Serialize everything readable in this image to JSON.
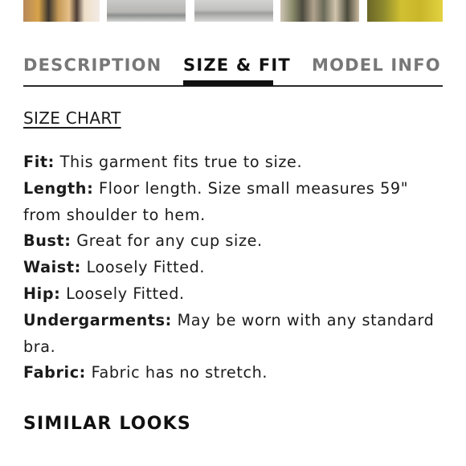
{
  "thumbnails": [
    {
      "label": "product-photo-1"
    },
    {
      "label": "product-photo-2"
    },
    {
      "label": "product-photo-3"
    },
    {
      "label": "product-photo-4"
    },
    {
      "label": "product-photo-5"
    }
  ],
  "tabs": [
    {
      "label": "DESCRIPTION",
      "active": false
    },
    {
      "label": "SIZE & FIT",
      "active": true
    },
    {
      "label": "MODEL INFO",
      "active": false
    }
  ],
  "size_chart_link": "SIZE CHART",
  "details": [
    {
      "label": "Fit:",
      "text": " This garment fits true to size."
    },
    {
      "label": "Length:",
      "text": " Floor length. Size small measures 59\" from shoulder to hem."
    },
    {
      "label": "Bust:",
      "text": " Great for any cup size."
    },
    {
      "label": "Waist:",
      "text": " Loosely Fitted."
    },
    {
      "label": "Hip:",
      "text": " Loosely Fitted."
    },
    {
      "label": "Undergarments:",
      "text": " May be worn with any standard bra."
    },
    {
      "label": "Fabric:",
      "text": " Fabric has no stretch."
    }
  ],
  "similar_heading": "SIMILAR LOOKS",
  "colors": {
    "text": "#1b1b1b",
    "tab_inactive": "#777777",
    "tab_active": "#111111",
    "background": "#ffffff"
  }
}
